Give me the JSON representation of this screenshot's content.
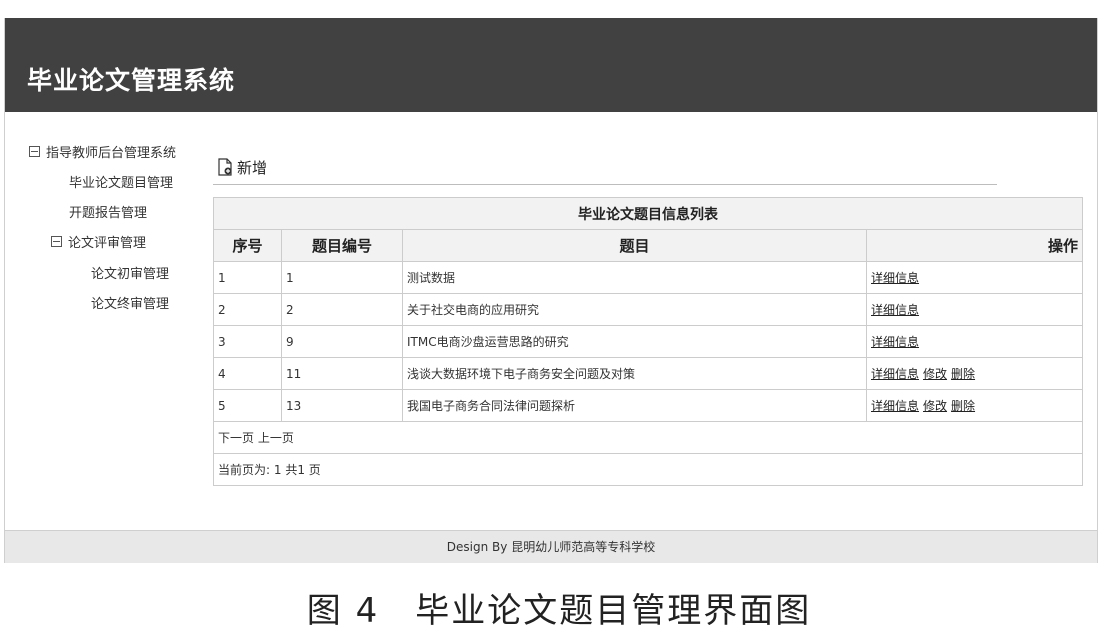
{
  "app": {
    "title": "毕业论文管理系统"
  },
  "sidebar": {
    "root": {
      "label": "指导教师后台管理系统"
    },
    "items": [
      {
        "label": "毕业论文题目管理"
      },
      {
        "label": "开题报告管理"
      }
    ],
    "review_group": {
      "label": "论文评审管理",
      "items": [
        {
          "label": "论文初审管理"
        },
        {
          "label": "论文终审管理"
        }
      ]
    }
  },
  "toolbar": {
    "add_label": "新增",
    "add_icon": "new-document-icon"
  },
  "table": {
    "caption": "毕业论文题目信息列表",
    "columns": [
      "序号",
      "题目编号",
      "题目",
      "操作"
    ],
    "rows": [
      {
        "seq": "1",
        "code": "1",
        "title": "测试数据",
        "actions": [
          "详细信息"
        ]
      },
      {
        "seq": "2",
        "code": "2",
        "title": "关于社交电商的应用研究",
        "actions": [
          "详细信息"
        ]
      },
      {
        "seq": "3",
        "code": "9",
        "title": "ITMC电商沙盘运营思路的研究",
        "actions": [
          "详细信息"
        ]
      },
      {
        "seq": "4",
        "code": "11",
        "title": "浅谈大数据环境下电子商务安全问题及对策",
        "actions": [
          "详细信息",
          "修改",
          "删除"
        ]
      },
      {
        "seq": "5",
        "code": "13",
        "title": "我国电子商务合同法律问题探析",
        "actions": [
          "详细信息",
          "修改",
          "删除"
        ]
      }
    ],
    "pagination": {
      "next": "下一页",
      "prev": "上一页"
    },
    "page_info": {
      "prefix": "当前页为:",
      "current": "1",
      "total_label": "共1 页"
    }
  },
  "footer": {
    "text": "Design By 昆明幼儿师范高等专科学校"
  },
  "figure_caption": "图 4　毕业论文题目管理界面图",
  "colors": {
    "header_bg": "#414141",
    "header_text": "#ffffff",
    "table_head_bg": "#f2f2f2",
    "footer_bg": "#e8e8e8"
  }
}
